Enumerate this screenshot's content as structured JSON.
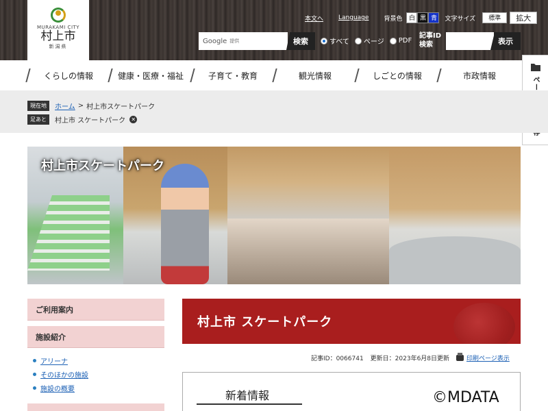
{
  "logo": {
    "en": "MURAKAMI CITY",
    "name": "村上市",
    "pref": "新潟県"
  },
  "top": {
    "honbun": "本文へ",
    "language": "Language",
    "bg_label": "背景色",
    "bg_white": "白",
    "bg_black": "黒",
    "bg_blue": "青",
    "size_label": "文字サイズ",
    "size_normal": "標準",
    "size_large": "拡大"
  },
  "search": {
    "google": "Google",
    "provided": "提供",
    "button": "検索",
    "options": [
      "すべて",
      "ページ",
      "PDF"
    ],
    "id_label_1": "記事ID",
    "id_label_2": "検索",
    "id_button": "表示"
  },
  "nav": [
    "くらしの情報",
    "健康・医療・福祉",
    "子育て・教育",
    "観光情報",
    "しごとの情報",
    "市政情報"
  ],
  "side_tab": "ページを一時保存",
  "breadcrumb": {
    "current_tag": "現在地",
    "home": "ホーム",
    "separator": ">",
    "current": "村上市スケートパーク",
    "trail_tag": "足あと",
    "trail_item": "村上市 スケートパーク"
  },
  "hero": {
    "title": "村上市スケートパーク"
  },
  "sidebar": {
    "guide": "ご利用案内",
    "facility": "施設紹介",
    "items": [
      "アリーナ",
      "そのほかの施設",
      "施設の概要"
    ]
  },
  "main": {
    "banner_title": "村上市 スケートパーク",
    "article_id": "記事ID：0066741",
    "updated": "更新日：2023年6月8日更新",
    "print": "印刷ページ表示",
    "news_title": "新着情報"
  },
  "watermark": "©MDATA",
  "colors": {
    "banner": "#a91e1e",
    "menu_head": "#f2d2d2",
    "link": "#1a5fb4"
  }
}
